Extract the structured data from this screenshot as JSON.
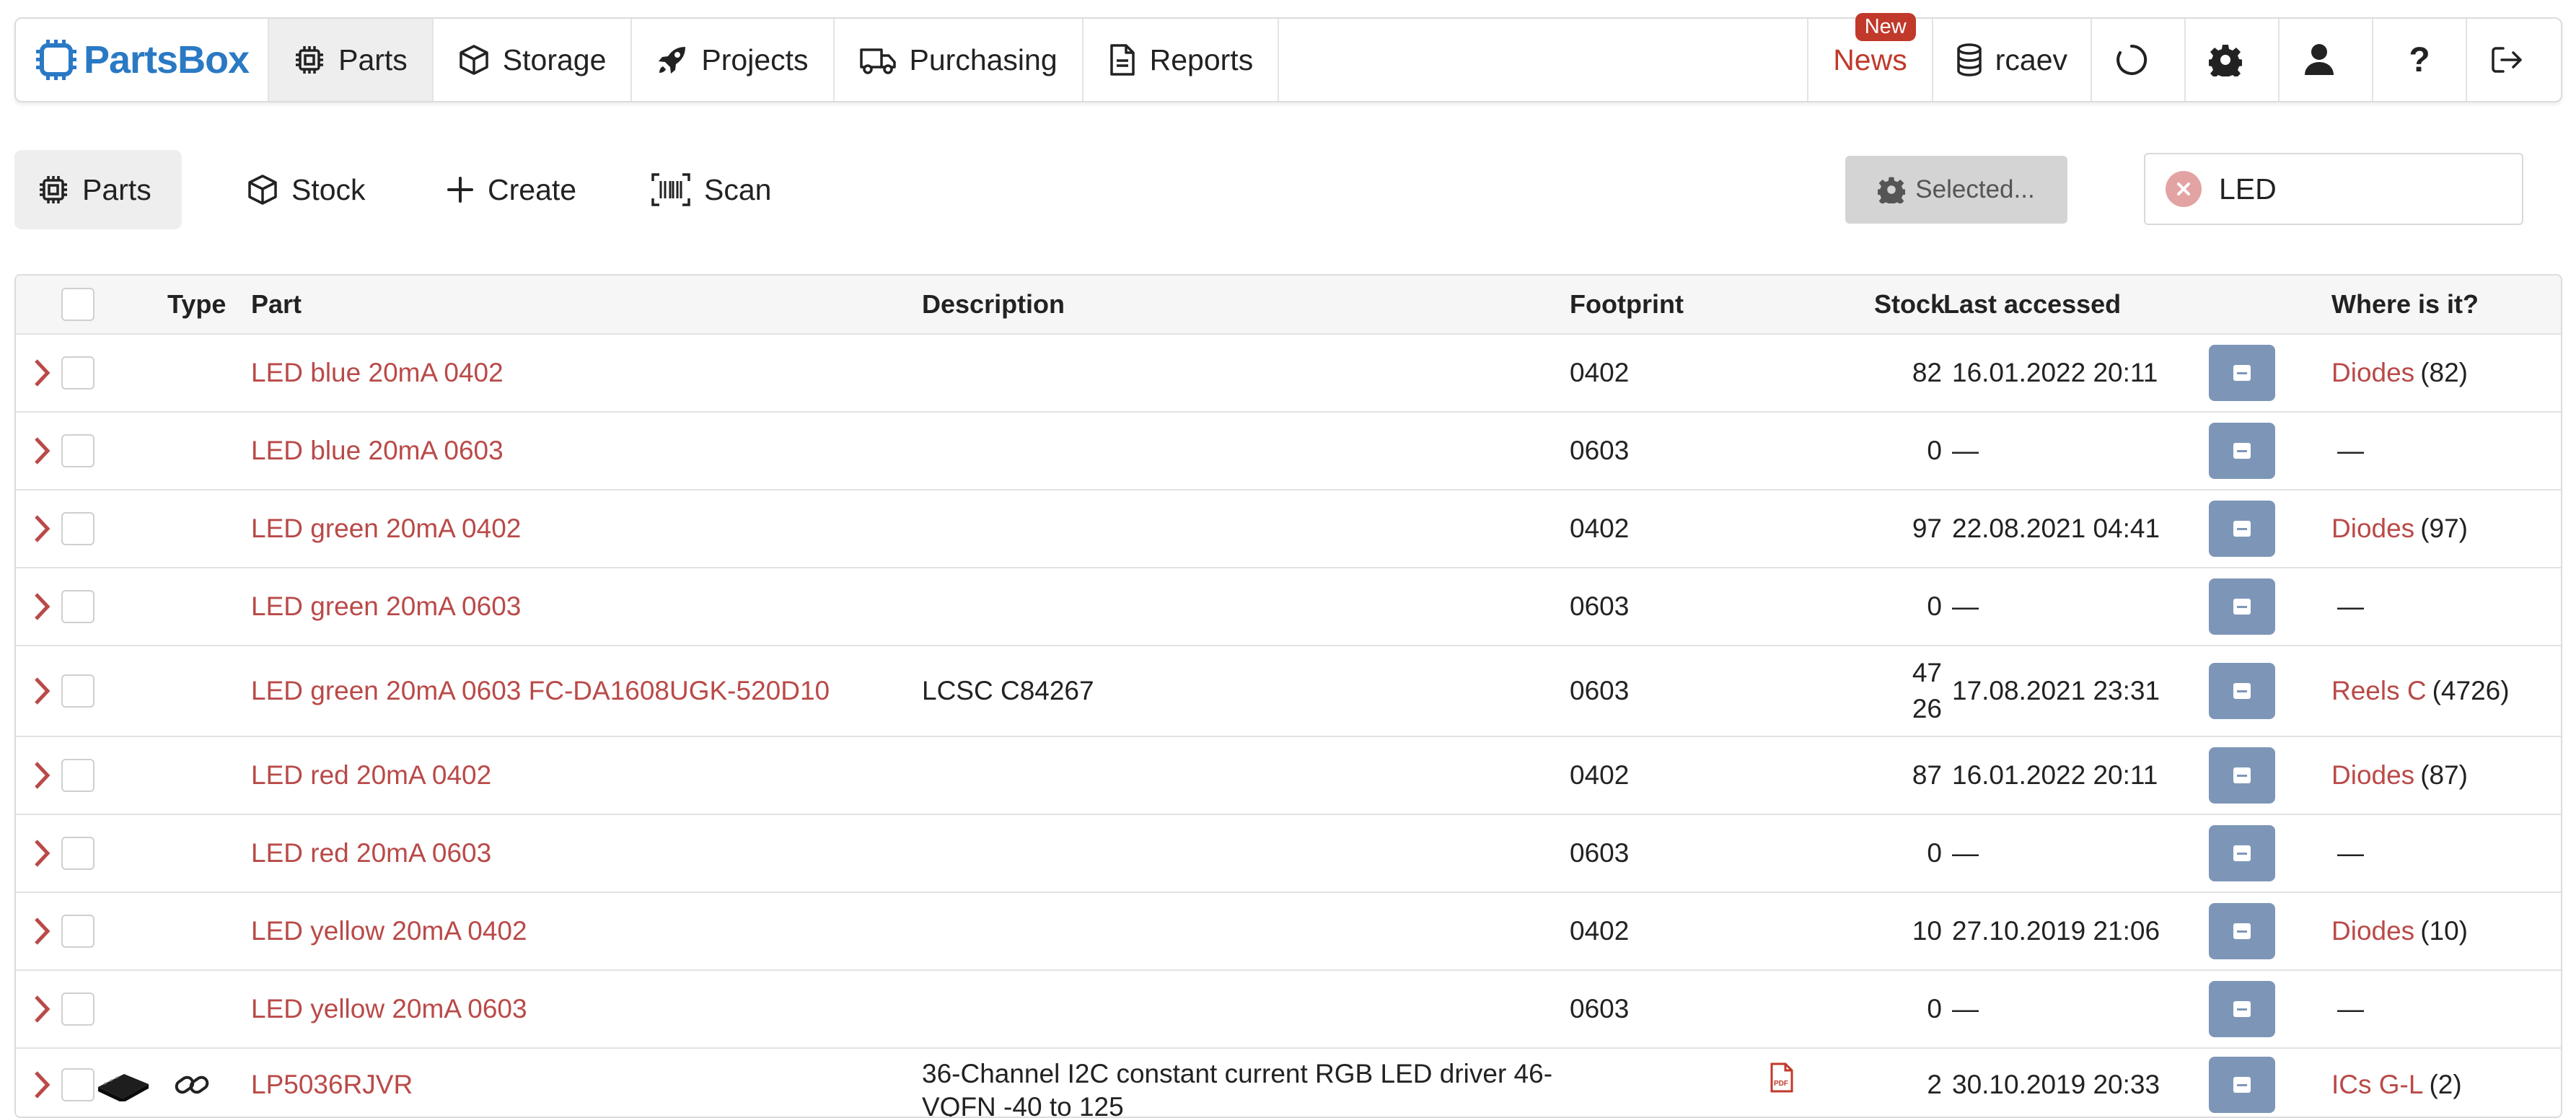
{
  "navbar": {
    "brand": "PartsBox",
    "items": [
      {
        "label": "Parts",
        "icon": "chip-icon"
      },
      {
        "label": "Storage",
        "icon": "box-icon"
      },
      {
        "label": "Projects",
        "icon": "rocket-icon"
      },
      {
        "label": "Purchasing",
        "icon": "truck-icon"
      },
      {
        "label": "Reports",
        "icon": "document-icon"
      }
    ],
    "news_label": "News",
    "news_badge": "New",
    "database_label": "rcaev",
    "icons": [
      "spinner-icon",
      "gear-icon",
      "user-icon",
      "help-icon",
      "logout-icon"
    ],
    "help_glyph": "?"
  },
  "toolbar": {
    "parts_label": "Parts",
    "stock_label": "Stock",
    "create_label": "Create",
    "scan_label": "Scan",
    "selected_label": "Selected...",
    "search_value": "LED"
  },
  "table": {
    "headers": {
      "type": "Type",
      "part": "Part",
      "description": "Description",
      "footprint": "Footprint",
      "stock": "Stock",
      "last_accessed": "Last accessed",
      "where": "Where is it?"
    },
    "rows": [
      {
        "part": "LED blue 20mA 0402",
        "description": "",
        "footprint": "0402",
        "stock": "82",
        "last_accessed": "16.01.2022 20:11",
        "location": "Diodes",
        "location_count": "(82)",
        "no_location": ""
      },
      {
        "part": "LED blue 20mA 0603",
        "description": "",
        "footprint": "0603",
        "stock": "0",
        "last_accessed": "—",
        "location": "",
        "location_count": "",
        "no_location": "—"
      },
      {
        "part": "LED green 20mA 0402",
        "description": "",
        "footprint": "0402",
        "stock": "97",
        "last_accessed": "22.08.2021 04:41",
        "location": "Diodes",
        "location_count": "(97)",
        "no_location": ""
      },
      {
        "part": "LED green 20mA 0603",
        "description": "",
        "footprint": "0603",
        "stock": "0",
        "last_accessed": "—",
        "location": "",
        "location_count": "",
        "no_location": "—"
      },
      {
        "part": "LED green 20mA 0603 FC-DA1608UGK-520D10",
        "description": "LCSC C84267",
        "footprint": "0603",
        "stock_line1": "47",
        "stock_line2": "26",
        "last_accessed": "17.08.2021 23:31",
        "location": "Reels C",
        "location_count": "(4726)",
        "no_location": ""
      },
      {
        "part": "LED red 20mA 0402",
        "description": "",
        "footprint": "0402",
        "stock": "87",
        "last_accessed": "16.01.2022 20:11",
        "location": "Diodes",
        "location_count": "(87)",
        "no_location": ""
      },
      {
        "part": "LED red 20mA 0603",
        "description": "",
        "footprint": "0603",
        "stock": "0",
        "last_accessed": "—",
        "location": "",
        "location_count": "",
        "no_location": "—"
      },
      {
        "part": "LED yellow 20mA 0402",
        "description": "",
        "footprint": "0402",
        "stock": "10",
        "last_accessed": "27.10.2019 21:06",
        "location": "Diodes",
        "location_count": "(10)",
        "no_location": ""
      },
      {
        "part": "LED yellow 20mA 0603",
        "description": "",
        "footprint": "0603",
        "stock": "0",
        "last_accessed": "—",
        "location": "",
        "location_count": "",
        "no_location": "—"
      },
      {
        "part": "LP5036RJVR",
        "description": "36-Channel I2C constant current RGB LED driver 46-VQFN -40 to 125",
        "footprint": "",
        "stock": "2",
        "last_accessed": "30.10.2019 20:33",
        "location": "ICs G-L",
        "location_count": "(2)",
        "no_location": "",
        "pdf": "PDF"
      }
    ]
  },
  "colors": {
    "brand": "#2a79c4",
    "link": "#b94a48",
    "news": "#c0392b",
    "stock_button": "#7d96b8"
  }
}
